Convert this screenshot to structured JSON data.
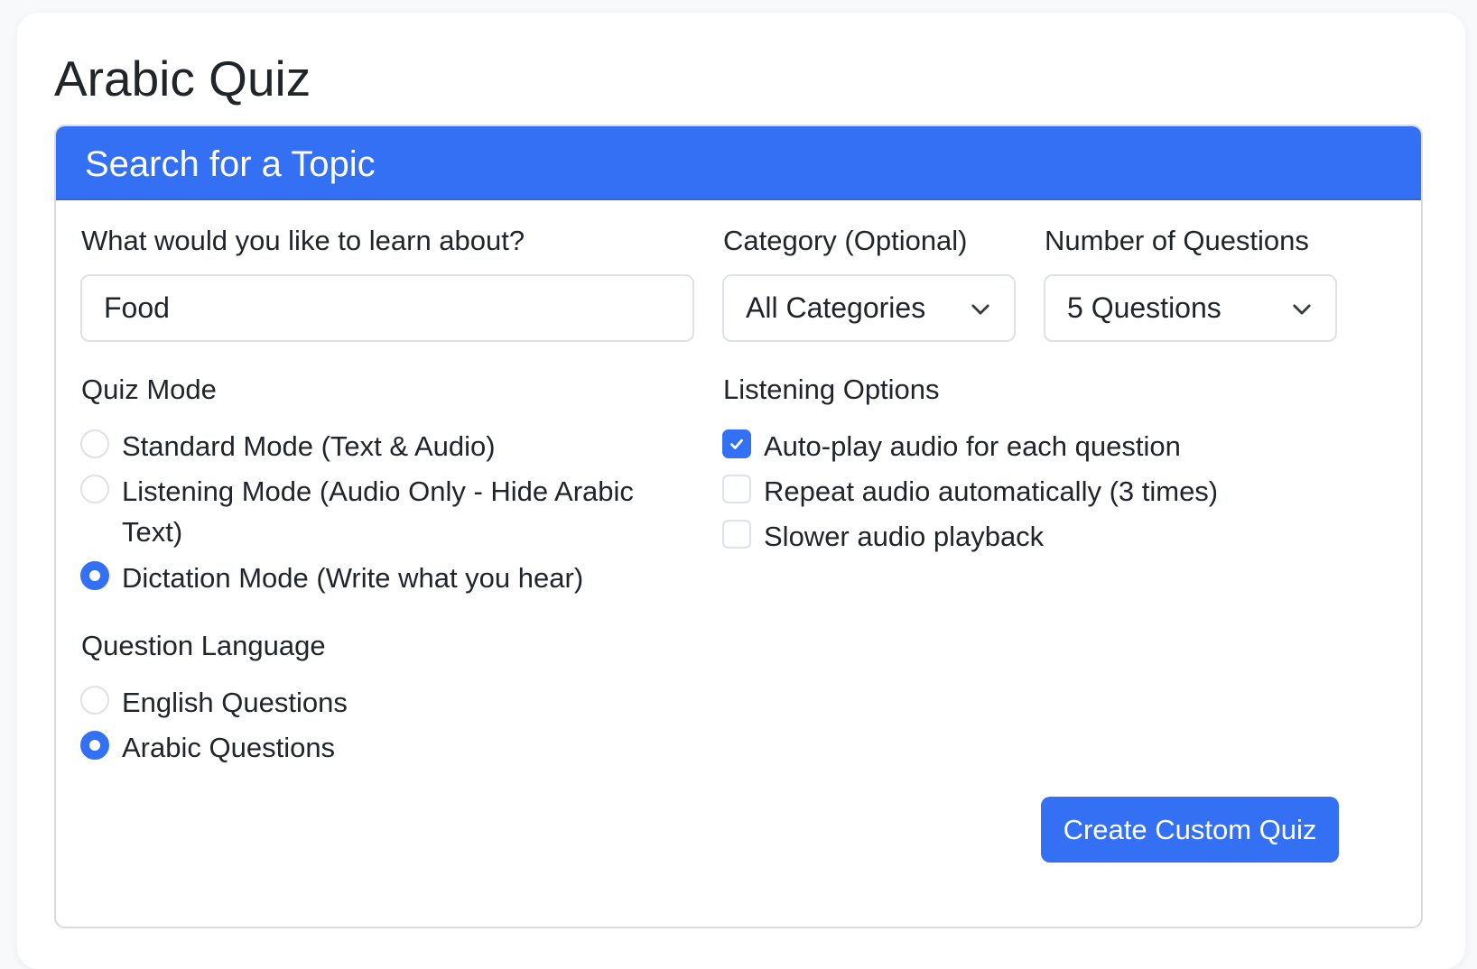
{
  "page": {
    "title": "Arabic Quiz"
  },
  "card": {
    "header_title": "Search for a Topic"
  },
  "topic": {
    "label": "What would you like to learn about?",
    "value": "Food"
  },
  "category": {
    "label": "Category (Optional)",
    "selected": "All Categories"
  },
  "num_questions": {
    "label": "Number of Questions",
    "selected": "5 Questions"
  },
  "quiz_mode": {
    "label": "Quiz Mode",
    "options": [
      {
        "label": "Standard Mode (Text & Audio)",
        "checked": false
      },
      {
        "label": "Listening Mode (Audio Only - Hide Arabic",
        "label_cont": "Text)",
        "checked": false
      },
      {
        "label": "Dictation Mode (Write what you hear)",
        "checked": true
      }
    ]
  },
  "question_language": {
    "label": "Question Language",
    "options": [
      {
        "label": "English Questions",
        "checked": false
      },
      {
        "label": "Arabic Questions",
        "checked": true
      }
    ]
  },
  "listening_options": {
    "label": "Listening Options",
    "options": [
      {
        "label": "Auto-play audio for each question",
        "checked": true
      },
      {
        "label": "Repeat audio automatically (3 times)",
        "checked": false
      },
      {
        "label": "Slower audio playback",
        "checked": false
      }
    ]
  },
  "submit": {
    "label": "Create Custom Quiz"
  },
  "colors": {
    "primary": "#3470f3",
    "border": "#dee2e6",
    "text": "#212529"
  }
}
